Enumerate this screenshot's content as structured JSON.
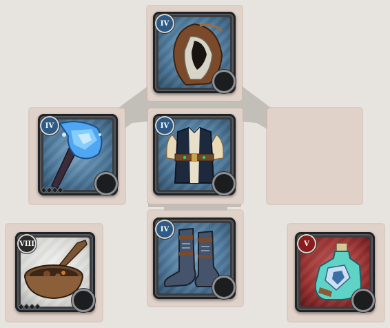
{
  "screen": "character-equipment",
  "colors": {
    "background": "#e7e4df",
    "parchment": "#e0d2c9",
    "silhouette": "#b5b1ab",
    "tier_blue": "#2e5a86",
    "tier_white": "#2a2a2a",
    "tier_red": "#8a1c1c"
  },
  "slots": {
    "head": {
      "tier": "IV",
      "icon": "leather-hood-icon",
      "rarity": "blue"
    },
    "main_hand": {
      "tier": "IV",
      "icon": "crystal-axe-icon",
      "rarity": "blue"
    },
    "chest": {
      "tier": "IV",
      "icon": "leather-jacket-icon",
      "rarity": "blue"
    },
    "off_hand": {
      "tier": "",
      "icon": "",
      "rarity": "empty"
    },
    "food": {
      "tier": "VIII",
      "icon": "stew-bowl-icon",
      "rarity": "white"
    },
    "shoes": {
      "tier": "IV",
      "icon": "plate-boots-icon",
      "rarity": "blue"
    },
    "potion": {
      "tier": "V",
      "icon": "resistance-potion-icon",
      "rarity": "red"
    }
  }
}
